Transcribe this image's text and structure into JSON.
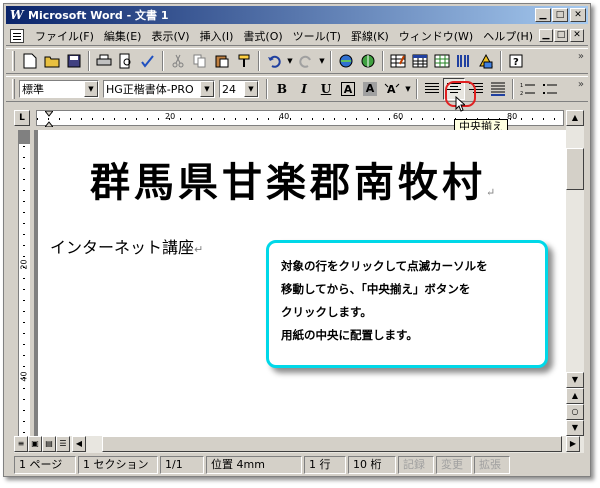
{
  "window": {
    "title": "Microsoft Word - 文書 1",
    "app_icon": "W",
    "minimize": "▁",
    "maximize": "□",
    "close": "✕"
  },
  "menu": {
    "items": [
      "ファイル(F)",
      "編集(E)",
      "表示(V)",
      "挿入(I)",
      "書式(O)",
      "ツール(T)",
      "罫線(K)",
      "ウィンドウ(W)",
      "ヘルプ(H)"
    ]
  },
  "format_toolbar": {
    "style_value": "標準",
    "font_value": "HG正楷書体-PRO",
    "size_value": "24",
    "bold": "B",
    "italic": "I",
    "underline": "U",
    "char_border": "A",
    "char_shading": "A"
  },
  "tooltip": "中央揃え",
  "ruler": {
    "h_numbers": [
      "20",
      "40",
      "60",
      "80"
    ],
    "v_numbers": [
      "20",
      "40"
    ]
  },
  "document": {
    "heading": "群馬県甘楽郡南牧村",
    "subline": "インターネット講座",
    "para_mark": "↵"
  },
  "callout": {
    "lines": [
      "対象の行をクリックして点滅カーソルを",
      "移動してから、「中央揃え」ボタンを",
      "クリックします。",
      "用紙の中央に配置します。"
    ]
  },
  "statusbar": {
    "page": "1 ページ",
    "section": "1 セクション",
    "pages": "1/1",
    "position": "位置 4mm",
    "line": "1 行",
    "column": "10 桁",
    "rec": "記録",
    "trk": "変更",
    "ext": "拡張"
  },
  "colors": {
    "callout_border": "#00d8e8",
    "highlight_ring": "#e02020",
    "title_bar": "#0a246a"
  }
}
